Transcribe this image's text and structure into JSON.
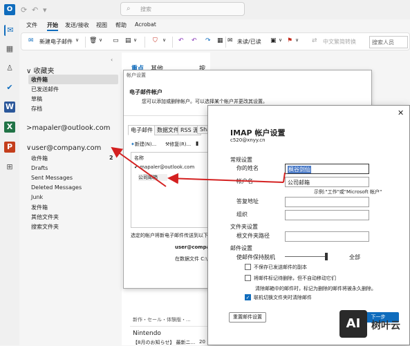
{
  "titlebar": {
    "logo": "O",
    "search_placeholder": "搜索",
    "icons": [
      "refresh-icon",
      "undo-icon",
      "dropdown-icon"
    ]
  },
  "rail": {
    "icons": [
      "mail-icon",
      "calendar-icon",
      "people-icon",
      "todo-icon",
      "word-icon",
      "excel-icon",
      "powerpoint-icon",
      "apps-icon"
    ]
  },
  "menu": [
    "文件",
    "开始",
    "发送/接收",
    "视图",
    "帮助",
    "Acrobat"
  ],
  "ribbon": {
    "new_mail": "新建电子邮件",
    "read_unread": "未读/已读",
    "translate": "中文繁简转换",
    "search_people": "搜索人员"
  },
  "folders": {
    "favorites": "收藏夹",
    "fav_items": [
      "收件箱",
      "已发送邮件",
      "草稿",
      "存档"
    ],
    "account1": "mapaler@outlook.com",
    "account2": "user@company.com",
    "account2_items": [
      "收件箱",
      "Drafts",
      "Sent Messages",
      "Deleted Messages",
      "Junk",
      "发件箱",
      "其他文件夹",
      "搜索文件夹"
    ],
    "inbox_count": "2"
  },
  "msglist": {
    "tab_focused": "重点",
    "tab_other": "其他",
    "sort": "按 日期 ∨",
    "tail_line": "新作・セール・体験版・...",
    "sender": "Nintendo",
    "subject": "【8月のお知らせ】 最新ニ...",
    "date_fragment": "20"
  },
  "acct": {
    "title": "帐户设置",
    "header_title": "电子邮件帐户",
    "header_desc": "您可以添加或删除帐户。可以选择某个帐户并更改其设置。",
    "tabs": [
      "电子邮件",
      "数据文件",
      "RSS 源",
      "Sha"
    ],
    "new_btn": "新建(N)...",
    "repair_btn": "修复(R)...",
    "col_name": "名称",
    "accounts": [
      "mapaler@outlook.com",
      "公司邮箱"
    ],
    "footer_desc": "选定的帐户将新电子邮件传送到以下位",
    "footer_account": "user@compan",
    "footer_path": "在数据文件 C:\\"
  },
  "imap": {
    "title": "IMAP 帐户设置",
    "email": "c520@xnyy.cn",
    "general": "常规设置",
    "your_name_label": "你的姓名",
    "your_name_value": "枫谷剑仙",
    "account_name_label": "帐户名",
    "account_name_value": "公司邮箱",
    "example": "示例:\"工作\"或\"Microsoft 帐户\"",
    "reply_label": "答复地址",
    "org_label": "组织",
    "folder_settings": "文件夹设置",
    "root_label": "根文件夹路径",
    "mail_settings": "邮件设置",
    "keep_offline": "使邮件保持脱机",
    "keep_offline_value": "全部",
    "opt1": "不保存已发送邮件的副本",
    "opt2": "将邮件标记待删除，但不自动移动它们",
    "opt2_note": "清除邮箱中的邮件时，标记为删除的邮件将被永久删除。",
    "opt3": "联机切换文件夹时清除邮件",
    "reset_btn": "重置邮件设置",
    "next_btn": "下一步"
  },
  "watermark": {
    "badge": "AI",
    "text": "树叶云"
  },
  "colors": {
    "accent": "#0f6cbd",
    "arrow": "#d42020"
  }
}
